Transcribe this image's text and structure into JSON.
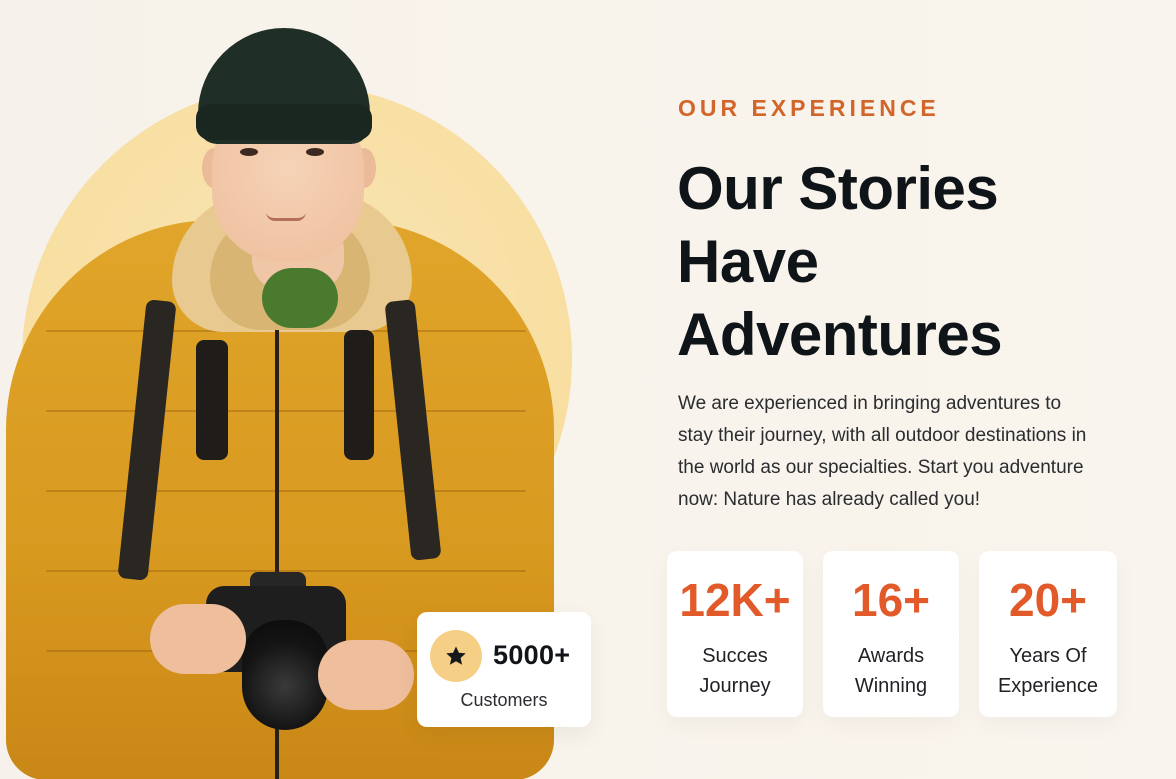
{
  "colors": {
    "accent": "#d2652a",
    "stat_accent": "#e25a2a",
    "background": "#f8f3eb",
    "sun": "#f8dea0",
    "text_dark": "#0f1419"
  },
  "hero": {
    "image_alt": "Young photographer in yellow puffer jacket holding camera",
    "customers_badge": {
      "icon": "star-icon",
      "count": "5000+",
      "label": "Customers"
    }
  },
  "content": {
    "eyebrow": "OUR EXPERIENCE",
    "headline": {
      "line1": "Our Stories",
      "line2": "Have",
      "line3": "Adventures"
    },
    "description": "We are experienced in bringing adventures to stay their journey, with all outdoor destinations in the world as our specialties. Start you adventure now: Nature has already called you!"
  },
  "stats": [
    {
      "value": "12K+",
      "label_line1": "Succes",
      "label_line2": "Journey"
    },
    {
      "value": "16+",
      "label_line1": "Awards",
      "label_line2": "Winning"
    },
    {
      "value": "20+",
      "label_line1": "Years Of",
      "label_line2": "Experience"
    }
  ]
}
